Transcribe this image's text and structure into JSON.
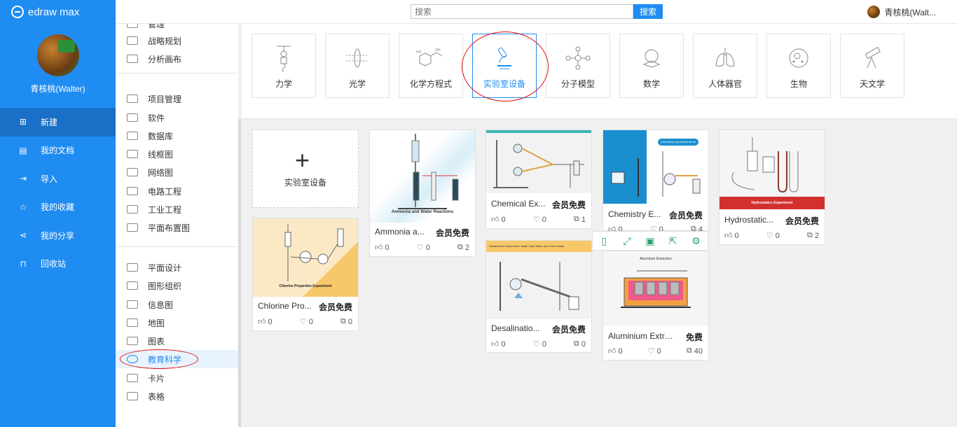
{
  "app": {
    "logo_text": "edraw max"
  },
  "user": {
    "name": "青核桃(Walter)",
    "name_short": "青核桃(Walt..."
  },
  "search": {
    "placeholder": "搜索",
    "button": "搜索"
  },
  "nav": [
    {
      "label": "新建",
      "icon": "new-file-icon",
      "active": true
    },
    {
      "label": "我的文档",
      "icon": "document-icon"
    },
    {
      "label": "导入",
      "icon": "import-icon"
    },
    {
      "label": "我的收藏",
      "icon": "star-icon"
    },
    {
      "label": "我的分享",
      "icon": "share-icon"
    },
    {
      "label": "回收站",
      "icon": "trash-icon"
    }
  ],
  "categories": [
    {
      "label": "管理",
      "icon": "manage-icon"
    },
    {
      "label": "战略规划",
      "icon": "strategy-icon"
    },
    {
      "label": "分析画布",
      "icon": "canvas-icon"
    },
    {
      "label": "项目管理",
      "icon": "project-icon"
    },
    {
      "label": "软件",
      "icon": "software-icon"
    },
    {
      "label": "数据库",
      "icon": "database-icon"
    },
    {
      "label": "线框图",
      "icon": "wireframe-icon"
    },
    {
      "label": "网络图",
      "icon": "network-icon"
    },
    {
      "label": "电路工程",
      "icon": "circuit-icon"
    },
    {
      "label": "工业工程",
      "icon": "industrial-icon"
    },
    {
      "label": "平面布置图",
      "icon": "floorplan-icon"
    },
    {
      "label": "平面设计",
      "icon": "graphic-design-icon"
    },
    {
      "label": "图形组织",
      "icon": "graphic-organizer-icon"
    },
    {
      "label": "信息图",
      "icon": "infographic-icon"
    },
    {
      "label": "地图",
      "icon": "map-icon"
    },
    {
      "label": "图表",
      "icon": "chart-icon"
    },
    {
      "label": "教育科学",
      "icon": "atom-icon",
      "active": true
    },
    {
      "label": "卡片",
      "icon": "card-icon"
    },
    {
      "label": "表格",
      "icon": "table-icon"
    }
  ],
  "subcategories": [
    {
      "label": "力学",
      "icon": "mechanics-icon"
    },
    {
      "label": "光学",
      "icon": "optics-icon"
    },
    {
      "label": "化学方程式",
      "icon": "chemical-equation-icon"
    },
    {
      "label": "实验室设备",
      "icon": "microscope-icon",
      "active": true
    },
    {
      "label": "分子模型",
      "icon": "molecule-icon"
    },
    {
      "label": "数学",
      "icon": "math-icon"
    },
    {
      "label": "人体器官",
      "icon": "lungs-icon"
    },
    {
      "label": "生物",
      "icon": "cell-icon"
    },
    {
      "label": "天文学",
      "icon": "telescope-icon"
    }
  ],
  "new_card": {
    "label": "实验室设备"
  },
  "templates": [
    {
      "title": "Ammonia a...",
      "badge": "会员免费",
      "likes": "0",
      "favorites": "0",
      "copies": "2",
      "thumb_caption": "Ammonia and Water Reactions"
    },
    {
      "title": "Chemical Ex...",
      "badge": "会员免费",
      "likes": "0",
      "favorites": "0",
      "copies": "1"
    },
    {
      "title": "Chemistry E...",
      "badge": "会员免费",
      "likes": "0",
      "favorites": "0",
      "copies": "4",
      "thumb_caption": "Chemistry experiment demo"
    },
    {
      "title": "Hydrostatic...",
      "badge": "会员免费",
      "likes": "0",
      "favorites": "0",
      "copies": "2",
      "thumb_caption": "Hydrostatics Experiment"
    },
    {
      "title": "Chlorine Pro...",
      "badge": "会员免费",
      "likes": "0",
      "favorites": "0",
      "copies": "0",
      "thumb_caption": "Chlorine Properties Experiment"
    },
    {
      "title": "Desalinatio...",
      "badge": "会员免费",
      "likes": "0",
      "favorites": "0",
      "copies": "0",
      "thumb_caption": "Desalination Experiment: Make Salty Water into Fresh Water"
    },
    {
      "title": "Aluminium Extra...",
      "badge": "免费",
      "likes": "0",
      "favorites": "0",
      "copies": "40",
      "thumb_caption": "Aluminum Extraction"
    }
  ],
  "hover_actions": [
    "preview-icon",
    "fullscreen-icon",
    "save-icon",
    "export-icon",
    "settings-icon"
  ],
  "colors": {
    "primary": "#1f8cf1",
    "nav_active": "#1a6fc6",
    "annotation_red": "#e01010",
    "hover_action": "#2aa36b"
  }
}
